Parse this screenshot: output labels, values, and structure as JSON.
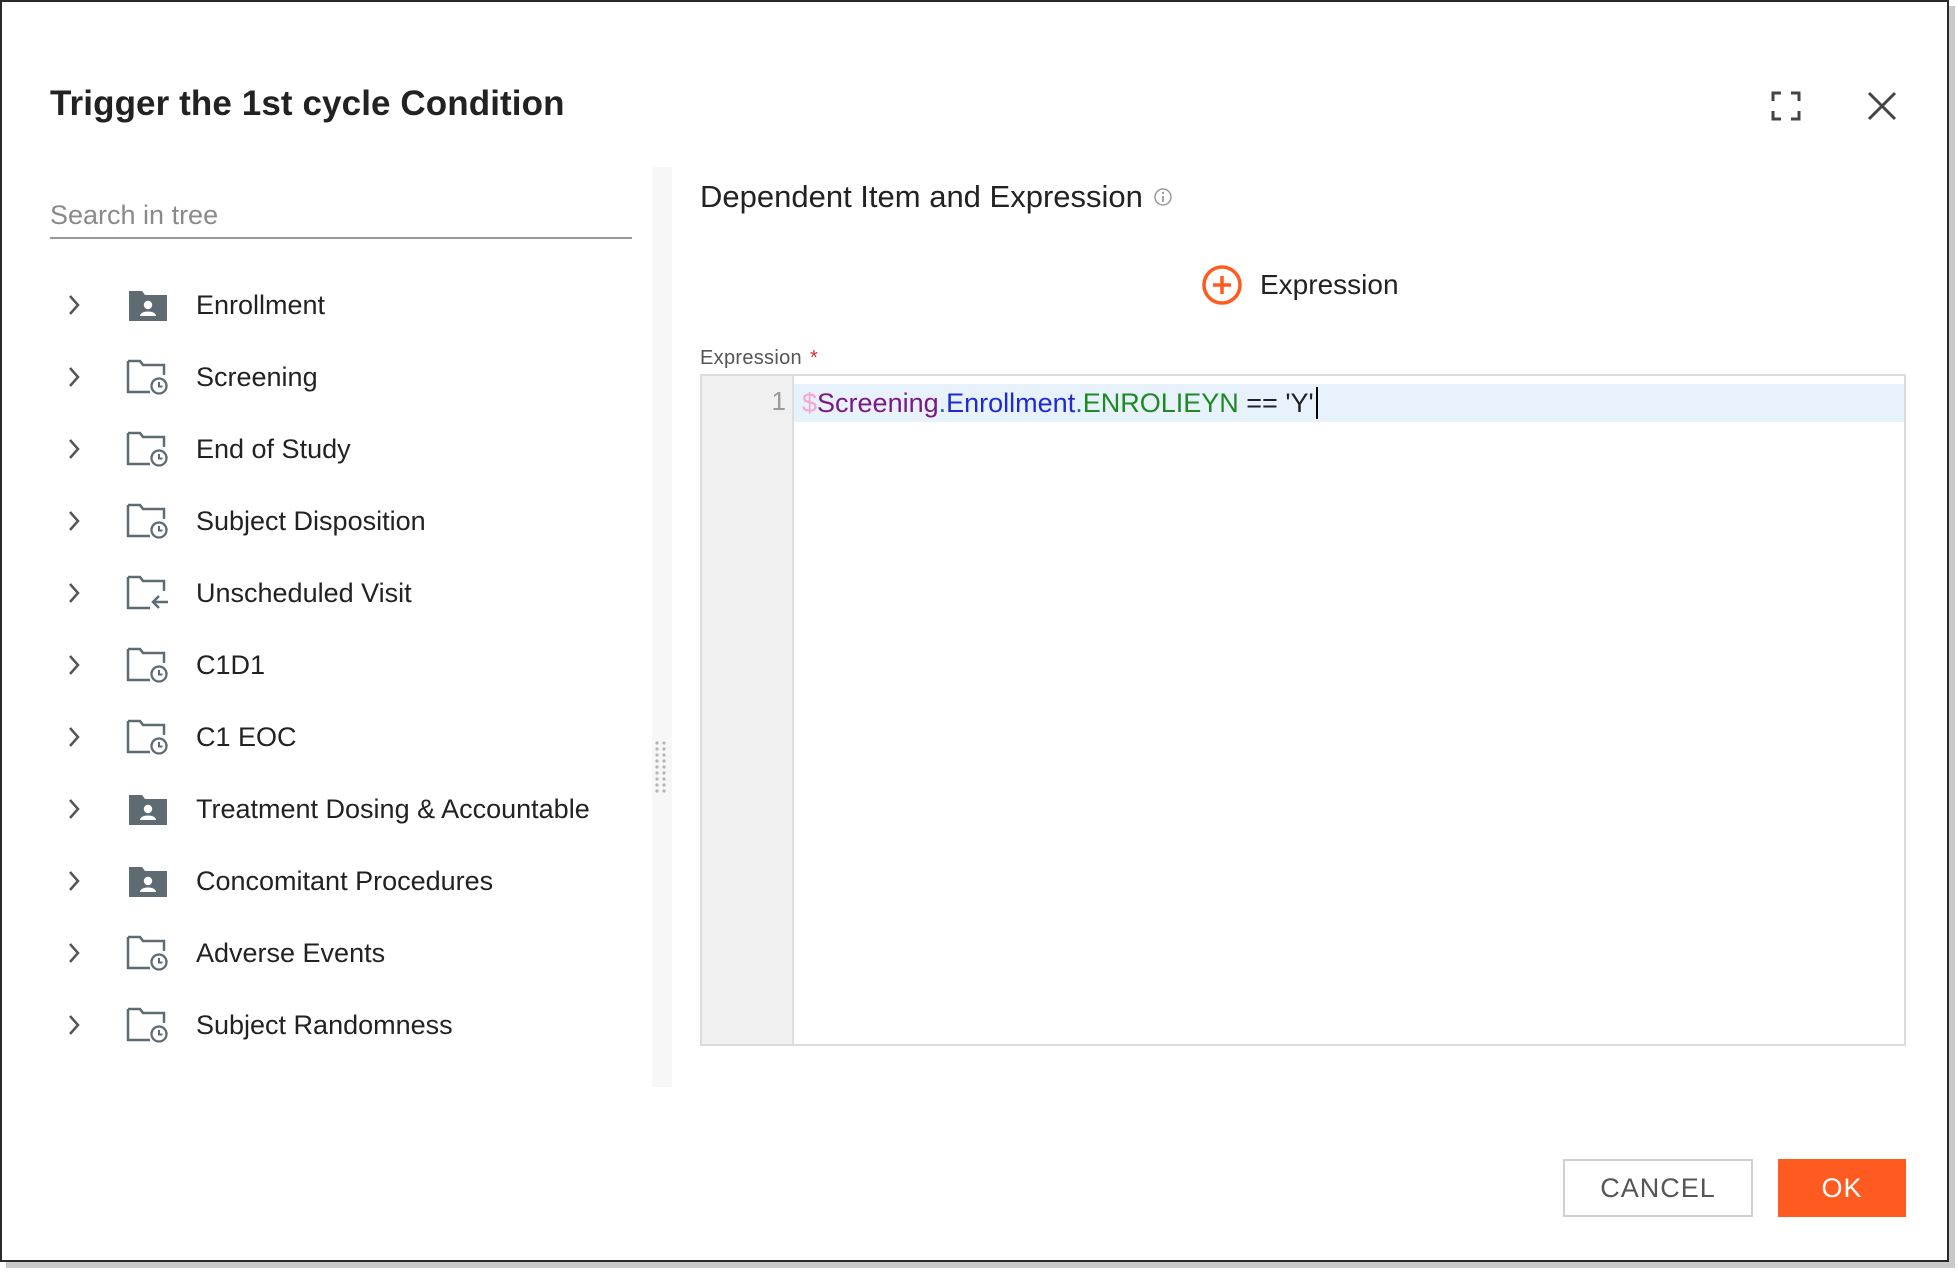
{
  "dialog": {
    "title": "Trigger the 1st cycle Condition",
    "fullscreen_icon": "fullscreen-icon",
    "close_icon": "close-icon"
  },
  "tree": {
    "search_placeholder": "Search in tree",
    "items": [
      {
        "label": "Enrollment",
        "icon": "folder-person-icon"
      },
      {
        "label": "Screening",
        "icon": "folder-clock-icon"
      },
      {
        "label": "End of Study",
        "icon": "folder-clock-icon"
      },
      {
        "label": "Subject Disposition",
        "icon": "folder-clock-icon"
      },
      {
        "label": "Unscheduled Visit",
        "icon": "folder-arrow-icon"
      },
      {
        "label": "C1D1",
        "icon": "folder-clock-icon"
      },
      {
        "label": "C1 EOC",
        "icon": "folder-clock-icon"
      },
      {
        "label": "Treatment Dosing & Accountable",
        "icon": "folder-person-icon"
      },
      {
        "label": "Concomitant Procedures",
        "icon": "folder-person-icon"
      },
      {
        "label": "Adverse Events",
        "icon": "folder-clock-icon"
      },
      {
        "label": "Subject Randomness",
        "icon": "folder-clock-icon"
      }
    ]
  },
  "expression_panel": {
    "title": "Dependent Item and Expression",
    "add_expression_label": "Expression",
    "field_label": "Expression",
    "required_mark": "*",
    "editor": {
      "line_number": "1",
      "tokens": {
        "dollar": "$",
        "part1": "Screening",
        "dot1": ".",
        "part2": "Enrollment",
        "dot2": ".",
        "part3": "ENROLIEYN",
        "operator": " == ",
        "value": "'Y'"
      }
    }
  },
  "footer": {
    "cancel_label": "CANCEL",
    "ok_label": "OK"
  },
  "colors": {
    "accent": "#ff5a1f",
    "icon_gray": "#5f6b73",
    "editor_highlight": "#e8f2fd"
  }
}
